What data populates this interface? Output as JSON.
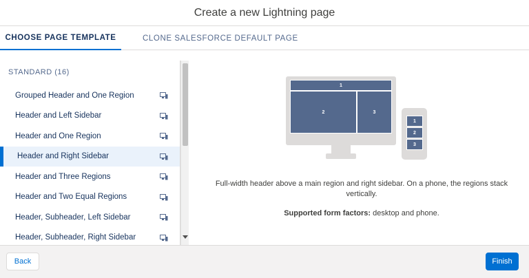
{
  "modal": {
    "title": "Create a new Lightning page"
  },
  "tabs": [
    {
      "label": "CHOOSE PAGE TEMPLATE",
      "active": true
    },
    {
      "label": "CLONE SALESFORCE DEFAULT PAGE",
      "active": false
    }
  ],
  "section": {
    "label": "STANDARD (16)"
  },
  "templates": [
    {
      "label": "Grouped Header and One Region",
      "icon": "desktop-phone-icon"
    },
    {
      "label": "Header and Left Sidebar",
      "icon": "desktop-phone-icon"
    },
    {
      "label": "Header and One Region",
      "icon": "desktop-phone-icon"
    },
    {
      "label": "Header and Right Sidebar",
      "icon": "desktop-phone-icon",
      "selected": true
    },
    {
      "label": "Header and Three Regions",
      "icon": "desktop-phone-icon"
    },
    {
      "label": "Header and Two Equal Regions",
      "icon": "desktop-phone-icon"
    },
    {
      "label": "Header, Subheader, Left Sidebar",
      "icon": "desktop-phone-icon"
    },
    {
      "label": "Header, Subheader, Right Sidebar",
      "icon": "desktop-phone-icon"
    }
  ],
  "preview": {
    "desktop_regions": [
      "1",
      "2",
      "3"
    ],
    "phone_regions": [
      "1",
      "2",
      "3"
    ],
    "description": "Full-width header above a main region and right sidebar. On a phone, the regions stack vertically.",
    "factors_label": "Supported form factors:",
    "factors_value": " desktop and phone."
  },
  "footer": {
    "back_label": "Back",
    "finish_label": "Finish"
  },
  "colors": {
    "accent": "#0070d2",
    "region": "#54698d",
    "device": "#dddbda"
  }
}
